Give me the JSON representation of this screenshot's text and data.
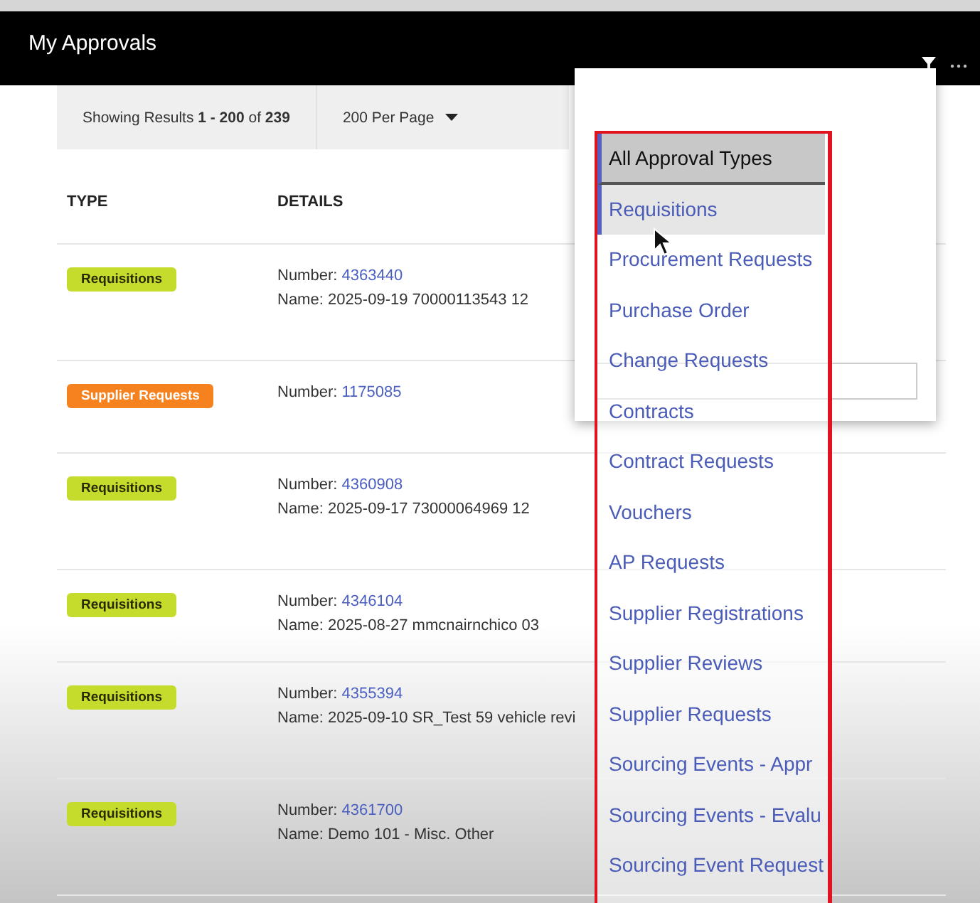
{
  "header": {
    "title": "My Approvals"
  },
  "results_bar": {
    "prefix": "Showing Results ",
    "range": "1 - 200",
    "of": " of ",
    "total": "239",
    "per_page": "200 Per Page"
  },
  "table": {
    "columns": [
      "TYPE",
      "DETAILS"
    ],
    "rows": [
      {
        "type": "Requisitions",
        "color": "#c6dc2c",
        "number_label": "Number: ",
        "number": "4363440",
        "name": "Name: 2025-09-19 70000113543 12"
      },
      {
        "type": "Supplier Requests",
        "color": "#f5821f",
        "number_label": "Number: ",
        "number": "1175085"
      },
      {
        "type": "Requisitions",
        "color": "#c6dc2c",
        "number_label": "Number: ",
        "number": "4360908",
        "name": "Name: 2025-09-17 73000064969 12"
      },
      {
        "type": "Requisitions",
        "color": "#c6dc2c",
        "number_label": "Number: ",
        "number": "4346104",
        "name": "Name: 2025-08-27 mmcnairnchico 03"
      },
      {
        "type": "Requisitions",
        "color": "#c6dc2c",
        "number_label": "Number: ",
        "number": "4355394",
        "name": "Name: 2025-09-10 SR_Test 59 vehicle revi"
      },
      {
        "type": "Requisitions",
        "color": "#c6dc2c",
        "number_label": "Number: ",
        "number": "4361700",
        "name": "Name: Demo 101 - Misc. Other"
      }
    ]
  },
  "type_dropdown": {
    "options": [
      {
        "label": "All Approval Types",
        "selected": true,
        "hovered": false
      },
      {
        "label": "Requisitions",
        "selected": false,
        "hovered": true
      },
      {
        "label": "Procurement Requests",
        "selected": false,
        "hovered": false
      },
      {
        "label": "Purchase Order",
        "selected": false,
        "hovered": false
      },
      {
        "label": "Change Requests",
        "selected": false,
        "hovered": false
      },
      {
        "label": "Contracts",
        "selected": false,
        "hovered": false
      },
      {
        "label": "Contract Requests",
        "selected": false,
        "hovered": false
      },
      {
        "label": "Vouchers",
        "selected": false,
        "hovered": false
      },
      {
        "label": "AP Requests",
        "selected": false,
        "hovered": false
      },
      {
        "label": "Supplier Registrations",
        "selected": false,
        "hovered": false
      },
      {
        "label": "Supplier Reviews",
        "selected": false,
        "hovered": false
      },
      {
        "label": "Supplier Requests",
        "selected": false,
        "hovered": false
      },
      {
        "label": "Sourcing Events - Appr",
        "selected": false,
        "hovered": false
      },
      {
        "label": "Sourcing Events - Evalu",
        "selected": false,
        "hovered": false
      },
      {
        "label": "Sourcing Event Request",
        "selected": false,
        "hovered": false
      }
    ]
  }
}
